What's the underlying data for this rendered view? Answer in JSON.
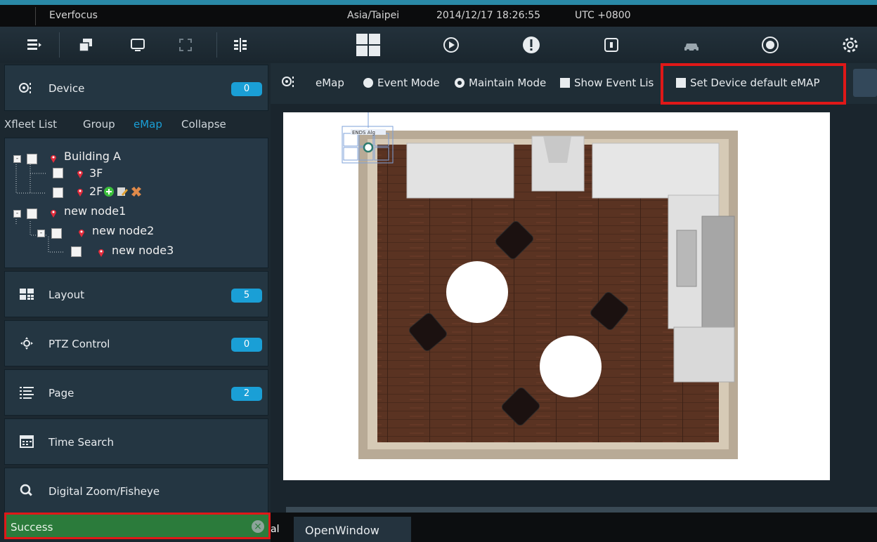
{
  "titlebar": {
    "app_name": "Everfocus",
    "timezone": "Asia/Taipei",
    "datetime": "2014/12/17 18:26:55",
    "utc": "UTC +0800"
  },
  "toolbar_icons": [
    "menu-icon",
    "windows-icon",
    "monitor-icon",
    "fullscreen-icon",
    "split-icon",
    "layout-grid-icon",
    "playback-icon",
    "alarm-icon",
    "lock-icon",
    "vehicle-icon",
    "network-icon",
    "gear-icon"
  ],
  "sidebar": {
    "device": {
      "label": "Device",
      "count": "0"
    },
    "tabs": [
      "Xfleet List",
      "Group",
      "eMap",
      "Collapse"
    ],
    "active_tab": "eMap",
    "tree": [
      {
        "label": "Building A",
        "level": 0
      },
      {
        "label": "3F",
        "level": 1
      },
      {
        "label": "2F",
        "level": 1
      },
      {
        "label": "new node1",
        "level": 0
      },
      {
        "label": "new node2",
        "level": 1
      },
      {
        "label": "new node3",
        "level": 2
      }
    ],
    "sections": [
      {
        "label": "Layout",
        "count": "5"
      },
      {
        "label": "PTZ Control",
        "count": "0"
      },
      {
        "label": "Page",
        "count": "2"
      },
      {
        "label": "Time Search",
        "count": ""
      },
      {
        "label": "Digital Zoom/Fisheye",
        "count": ""
      }
    ],
    "status": "Success"
  },
  "main": {
    "title": "eMap",
    "event_mode": "Event Mode",
    "maintain_mode": "Maintain Mode",
    "show_event_list": "Show Event Lis",
    "set_default": "Set Device default eMAP",
    "selected_mode": "Maintain Mode",
    "map_marker_label": "ENDS Alg"
  },
  "bottom": {
    "lead": "al",
    "tab": "OpenWindow"
  },
  "colors": {
    "accent": "#1a9fd6",
    "highlight": "#e01818",
    "success": "#2b7b3b",
    "floor": "#5a3322"
  }
}
